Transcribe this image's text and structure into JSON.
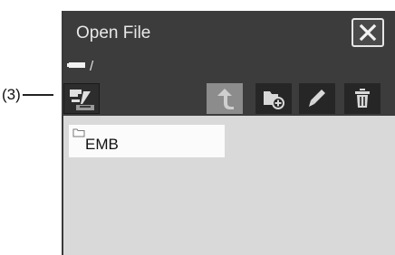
{
  "callout": {
    "label": "(3)"
  },
  "dialog": {
    "title": "Open File",
    "path": "/",
    "icons": {
      "close": "close-icon",
      "drive": "drive-icon",
      "media": "media-select-icon",
      "up": "up-arrow-icon",
      "new_folder": "new-folder-icon",
      "rename": "pencil-icon",
      "delete": "trash-icon",
      "folder": "folder-icon"
    },
    "files": [
      {
        "name": "EMB",
        "type": "folder"
      }
    ]
  },
  "colors": {
    "title_bar": "#3c3c3c",
    "panel": "#d9d9d9",
    "button_dark": "#262626",
    "button_disabled": "#8c8c8c",
    "item_bg": "#fbfbfb"
  }
}
